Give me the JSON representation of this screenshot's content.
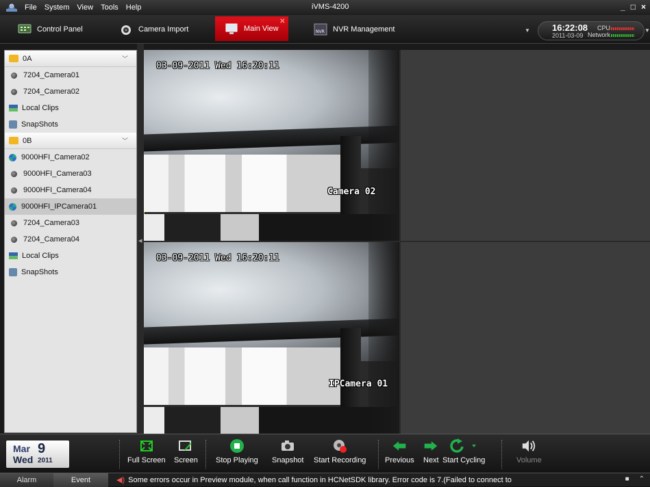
{
  "window": {
    "title": "iVMS-4200",
    "menu": [
      "File",
      "System",
      "View",
      "Tools",
      "Help"
    ],
    "controls": [
      "_",
      "□",
      "×"
    ]
  },
  "tabs": [
    {
      "label": "Control Panel",
      "icon": "control-panel-icon",
      "active": false
    },
    {
      "label": "Camera Import",
      "icon": "camera-import-icon",
      "active": false
    },
    {
      "label": "Main View",
      "icon": "main-view-icon",
      "active": true
    },
    {
      "label": "NVR Management",
      "icon": "nvr-icon",
      "active": false
    }
  ],
  "clock": {
    "time": "16:22:08",
    "date": "2011-03-09",
    "cpu_label": "CPU",
    "network_label": "Network"
  },
  "sidebar": {
    "groups": [
      {
        "name": "0A",
        "items": [
          {
            "label": "7204_Camera01",
            "icon": "camera"
          },
          {
            "label": "7204_Camera02",
            "icon": "camera"
          },
          {
            "label": "Local Clips",
            "icon": "clips"
          },
          {
            "label": "SnapShots",
            "icon": "snapshot"
          }
        ]
      },
      {
        "name": "0B",
        "items": [
          {
            "label": "9000HFI_Camera02",
            "icon": "ipcamera"
          },
          {
            "label": "9000HFI_Camera03",
            "icon": "camera"
          },
          {
            "label": "9000HFI_Camera04",
            "icon": "camera"
          },
          {
            "label": "9000HFI_IPCamera01",
            "icon": "ipcamera",
            "selected": true
          },
          {
            "label": "7204_Camera03",
            "icon": "camera"
          },
          {
            "label": "7204_Camera04",
            "icon": "camera"
          },
          {
            "label": "Local Clips",
            "icon": "clips"
          },
          {
            "label": "SnapShots",
            "icon": "snapshot"
          }
        ]
      }
    ]
  },
  "views": [
    {
      "timestamp": "03-09-2011 Wed 16:20:11",
      "camera_label": "Camera 02",
      "selected": true
    },
    {
      "timestamp": "03-09-2011 Wed 16:20:11",
      "camera_label": "IPCamera 01",
      "selected": false
    }
  ],
  "datebox": {
    "month": "Mar",
    "day": "9",
    "weekday": "Wed",
    "year": "2011"
  },
  "toolbar": {
    "full_screen": "Full Screen",
    "screen": "Screen",
    "stop_playing": "Stop Playing",
    "snapshot": "Snapshot",
    "start_recording": "Start Recording",
    "previous": "Previous",
    "next": "Next",
    "start_cycling": "Start Cycling",
    "volume": "Volume"
  },
  "statusbar": {
    "alarm_tab": "Alarm",
    "event_tab": "Event",
    "message": "Some errors occur in Preview module, when call function in HCNetSDK library. Error code is 7.(Failed to connect to"
  },
  "colors": {
    "active_tab": "#c8000a",
    "selected_pane_border": "#c8c200",
    "accent_green": "#22b14c",
    "date_text": "#2b3a68"
  }
}
